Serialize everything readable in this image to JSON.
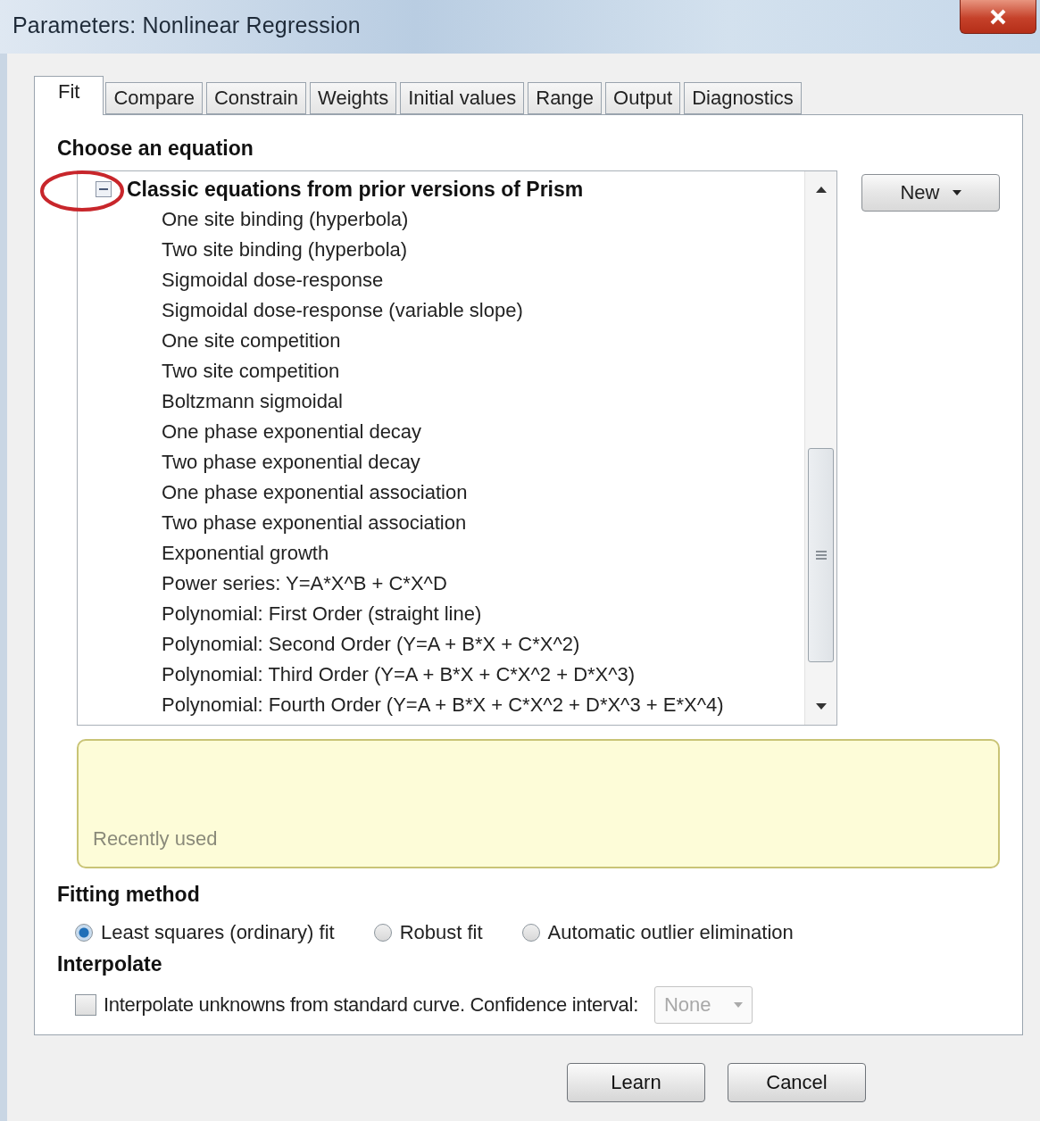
{
  "window": {
    "title": "Parameters: Nonlinear Regression"
  },
  "tabs": [
    {
      "label": "Fit",
      "selected": true
    },
    {
      "label": "Compare",
      "selected": false
    },
    {
      "label": "Constrain",
      "selected": false
    },
    {
      "label": "Weights",
      "selected": false
    },
    {
      "label": "Initial values",
      "selected": false
    },
    {
      "label": "Range",
      "selected": false
    },
    {
      "label": "Output",
      "selected": false
    },
    {
      "label": "Diagnostics",
      "selected": false
    }
  ],
  "equation_section": {
    "heading": "Choose an equation",
    "new_button": "New",
    "tree": [
      {
        "label": "Classic equations from prior versions of Prism",
        "expanded": true,
        "children": [
          {
            "label": "One site binding (hyperbola)"
          },
          {
            "label": "Two site binding (hyperbola)"
          },
          {
            "label": "Sigmoidal dose-response"
          },
          {
            "label": "Sigmoidal dose-response (variable slope)"
          },
          {
            "label": "One site competition"
          },
          {
            "label": "Two site competition"
          },
          {
            "label": "Boltzmann sigmoidal"
          },
          {
            "label": "One phase exponential decay"
          },
          {
            "label": "Two phase exponential decay"
          },
          {
            "label": "One phase exponential association"
          },
          {
            "label": "Two phase exponential association"
          },
          {
            "label": "Exponential growth"
          },
          {
            "label": "Power series: Y=A*X^B + C*X^D"
          },
          {
            "label": "Polynomial: First Order (straight line)"
          },
          {
            "label": "Polynomial: Second Order (Y=A + B*X + C*X^2)"
          },
          {
            "label": "Polynomial: Third Order (Y=A + B*X + C*X^2 + D*X^3)"
          },
          {
            "label": "Polynomial: Fourth Order (Y=A + B*X + C*X^2 + D*X^3 + E*X^4)"
          }
        ]
      }
    ]
  },
  "recently_used": {
    "label": "Recently used"
  },
  "fitting_method": {
    "heading": "Fitting method",
    "options": [
      {
        "label": "Least squares (ordinary) fit",
        "selected": true
      },
      {
        "label": "Robust fit",
        "selected": false
      },
      {
        "label": "Automatic outlier elimination",
        "selected": false
      }
    ]
  },
  "interpolate": {
    "heading": "Interpolate",
    "checkbox": {
      "label": "Interpolate unknowns from standard curve. Confidence interval:",
      "checked": false
    },
    "confidence_interval": {
      "value": "None",
      "disabled": true
    }
  },
  "buttons": [
    {
      "label": "Learn"
    },
    {
      "label": "Cancel"
    }
  ]
}
